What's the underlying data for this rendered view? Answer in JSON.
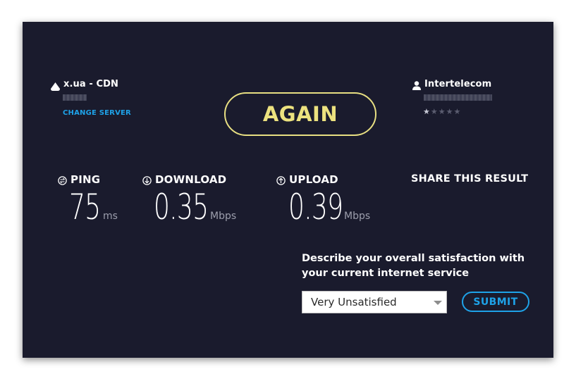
{
  "server": {
    "name": "x.ua - CDN",
    "change_label": "CHANGE SERVER",
    "icon": "server-pin-icon"
  },
  "isp": {
    "name": "Intertelecom",
    "icon": "user-icon",
    "rating": 1,
    "rating_max": 5
  },
  "again_label": "AGAIN",
  "metrics": {
    "ping": {
      "label": "PING",
      "value": "75",
      "unit": "ms",
      "icon": "ping-icon"
    },
    "download": {
      "label": "DOWNLOAD",
      "value": "0.35",
      "unit": "Mbps",
      "icon": "download-arrow-icon"
    },
    "upload": {
      "label": "UPLOAD",
      "value": "0.39",
      "unit": "Mbps",
      "icon": "upload-arrow-icon"
    }
  },
  "share_label": "SHARE THIS RESULT",
  "survey": {
    "question_line1": "Describe your overall satisfaction with",
    "question_line2": "your current internet service",
    "selected_option": "Very Unsatisfied",
    "submit_label": "SUBMIT"
  },
  "colors": {
    "background": "#1a1b2d",
    "accent_yellow": "#ece27f",
    "accent_blue": "#1ea2e8"
  }
}
